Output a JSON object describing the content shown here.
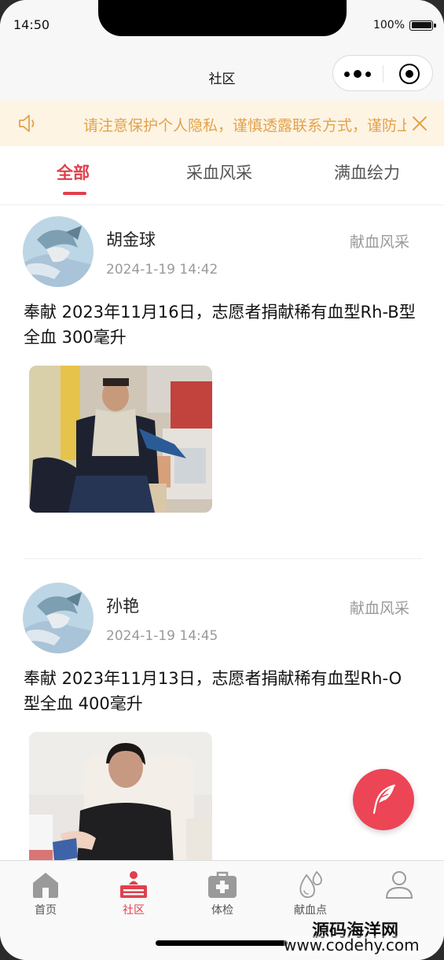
{
  "status_bar": {
    "time": "14:50",
    "battery": "100%"
  },
  "navbar": {
    "title": "社区"
  },
  "notice": {
    "text": "请注意保护个人隐私，谨慎透露联系方式，谨防上当受骗"
  },
  "tabs": [
    {
      "label": "全部",
      "active": true
    },
    {
      "label": "采血风采",
      "active": false
    },
    {
      "label": "满血绘力",
      "active": false
    }
  ],
  "posts": [
    {
      "author": "胡金球",
      "category": "献血风采",
      "time": "2024-1-19 14:42",
      "content": "奉献 2023年11月16日，志愿者捐献稀有血型Rh-B型全血 300毫升"
    },
    {
      "author": "孙艳",
      "category": "献血风采",
      "time": "2024-1-19 14:45",
      "content": "奉献 2023年11月13日，志愿者捐献稀有血型Rh-O型全血 400毫升"
    }
  ],
  "tabbar": [
    {
      "label": "首页",
      "icon": "home-icon",
      "active": false
    },
    {
      "label": "社区",
      "icon": "community-icon",
      "active": true
    },
    {
      "label": "体检",
      "icon": "medical-kit-icon",
      "active": false
    },
    {
      "label": "献血点",
      "icon": "blood-drop-icon",
      "active": false
    },
    {
      "label": "",
      "icon": "user-icon",
      "active": false
    }
  ],
  "watermark": {
    "line1": "源码海洋网",
    "line2": "www.codehy.com"
  },
  "colors": {
    "accent": "#e0404c",
    "notice_bg": "#fdf4e4",
    "notice_text": "#e3a24a",
    "fab": "#ec4556"
  }
}
